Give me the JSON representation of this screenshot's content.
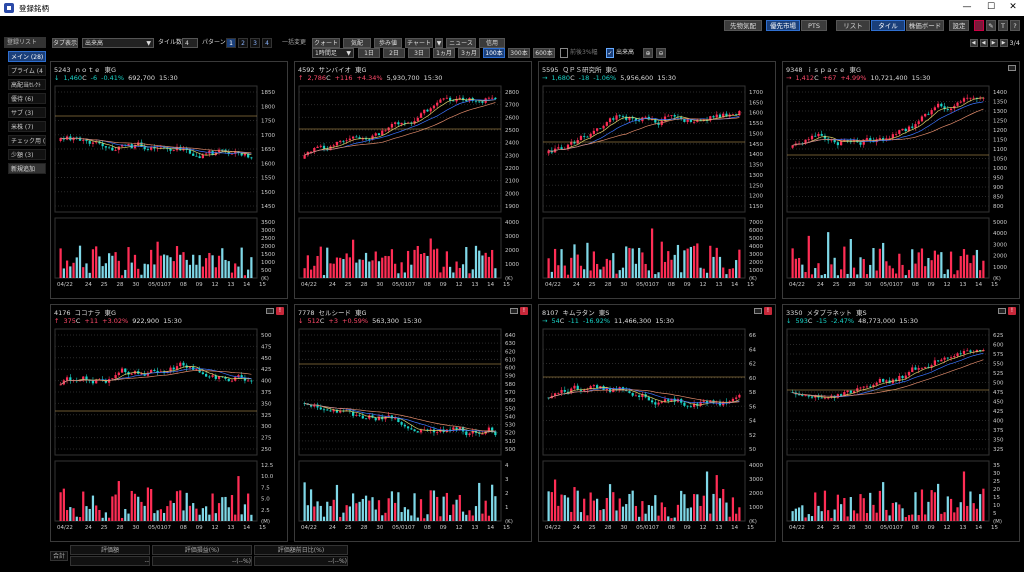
{
  "window": {
    "title": "登録銘柄",
    "minimize": "—",
    "maximize": "☐",
    "close": "✕"
  },
  "toolbar": {
    "buttons": [
      "先物気配",
      "優先市場",
      "PTS",
      "リスト",
      "タイル",
      "株価ボード",
      "設定"
    ]
  },
  "sidebar": {
    "header": "登録リスト",
    "items": [
      {
        "label": "メイン (28)",
        "active": true
      },
      {
        "label": "プライム (4",
        "active": false
      },
      {
        "label": "高配当ｾﾚｸﾄ",
        "active": false
      },
      {
        "label": "優待 (6)",
        "active": false
      },
      {
        "label": "サブ (3)",
        "active": false
      },
      {
        "label": "米株 (7)",
        "active": false
      },
      {
        "label": "チェック用 (",
        "active": false
      },
      {
        "label": "少額 (3)",
        "active": false
      }
    ],
    "add_label": "新規追加"
  },
  "controls": {
    "tab_label": "タブ表示",
    "sort_value": "出来高",
    "tile_count_label": "タイル数",
    "tile_count_value": "4",
    "pattern_label": "パターン",
    "patterns": [
      "1",
      "2",
      "3",
      "4"
    ],
    "bulk_change_label": "一括変更",
    "views": [
      "クォート",
      "気配",
      "歩み値",
      "チャート",
      "ニュース",
      "信用"
    ],
    "interval_value": "1時間足",
    "ranges": [
      "1日",
      "2日",
      "3日",
      "1ヵ月",
      "3ヵ月",
      "100本",
      "300本",
      "600本"
    ],
    "ranges_active": "100本",
    "check_limit_label": "前後3%幅",
    "check_volume_label": "出来高",
    "page_indicator": "3/4"
  },
  "tiles": [
    {
      "code": "5243",
      "name": "ｎｏｔｅ",
      "market": "東G",
      "arrow": "↓",
      "price": "1,460",
      "price_mark": "C",
      "change": "-6",
      "change_pct": "-0.41%",
      "volume": "692,700",
      "time": "15:30",
      "dir": "dn",
      "badge": "",
      "price_axis": [
        "1850",
        "1800",
        "1750",
        "1700",
        "1650",
        "1600",
        "1550",
        "1500",
        "1450"
      ],
      "vol_axis": [
        "3500",
        "3000",
        "2500",
        "2000",
        "1500",
        "1000",
        "500",
        "(K)"
      ],
      "x_axis": [
        "04/22",
        "24",
        "25",
        "28",
        "30",
        "05/01",
        "07",
        "08",
        "09",
        "12",
        "13",
        "14",
        "15"
      ]
    },
    {
      "code": "4592",
      "name": "サンバイオ",
      "market": "東G",
      "arrow": "↑",
      "price": "2,786",
      "price_mark": "C",
      "change": "+116",
      "change_pct": "+4.34%",
      "volume": "5,930,700",
      "time": "15:30",
      "dir": "up",
      "badge": "",
      "price_axis": [
        "2800",
        "2700",
        "2600",
        "2500",
        "2400",
        "2300",
        "2200",
        "2100",
        "2000",
        "1900"
      ],
      "vol_axis": [
        "4000",
        "3000",
        "2000",
        "1000",
        "(K)"
      ],
      "x_axis": [
        "04/22",
        "24",
        "25",
        "28",
        "30",
        "05/01",
        "07",
        "08",
        "09",
        "12",
        "13",
        "14",
        "15"
      ]
    },
    {
      "code": "5595",
      "name": "ＱＰＳ研究所",
      "market": "東G",
      "arrow": "→",
      "price": "1,680",
      "price_mark": "C",
      "change": "-18",
      "change_pct": "-1.06%",
      "volume": "5,956,600",
      "time": "15:30",
      "dir": "dn",
      "badge": "",
      "price_axis": [
        "1700",
        "1650",
        "1600",
        "1550",
        "1500",
        "1450",
        "1400",
        "1350",
        "1300",
        "1250",
        "1200",
        "1150"
      ],
      "vol_axis": [
        "7000",
        "6000",
        "5000",
        "4000",
        "3000",
        "2000",
        "1000",
        "(K)"
      ],
      "x_axis": [
        "04/22",
        "24",
        "25",
        "28",
        "30",
        "05/01",
        "07",
        "08",
        "09",
        "12",
        "13",
        "14",
        "15"
      ]
    },
    {
      "code": "9348",
      "name": "ｉｓｐａｃｅ",
      "market": "東G",
      "arrow": "→",
      "price": "1,412",
      "price_mark": "C",
      "change": "+67",
      "change_pct": "+4.99%",
      "volume": "10,721,400",
      "time": "15:30",
      "dir": "up",
      "badge": "",
      "price_axis": [
        "1400",
        "1350",
        "1300",
        "1250",
        "1200",
        "1150",
        "1100",
        "1050",
        "1000",
        "950",
        "900",
        "850",
        "800"
      ],
      "vol_axis": [
        "5000",
        "4000",
        "3000",
        "2000",
        "1000",
        "(K)"
      ],
      "x_axis": [
        "04/22",
        "24",
        "25",
        "28",
        "30",
        "05/01",
        "07",
        "08",
        "09",
        "12",
        "13",
        "14",
        "15"
      ]
    },
    {
      "code": "4176",
      "name": "ココナラ",
      "market": "東G",
      "arrow": "↑",
      "price": "375",
      "price_mark": "C",
      "change": "+11",
      "change_pct": "+3.02%",
      "volume": "922,900",
      "time": "15:30",
      "dir": "up",
      "badge": "!",
      "price_axis": [
        "500",
        "475",
        "450",
        "425",
        "400",
        "375",
        "350",
        "325",
        "300",
        "275",
        "250"
      ],
      "vol_axis": [
        "12.5",
        "10.0",
        "7.5",
        "5.0",
        "2.5",
        "(M)"
      ],
      "x_axis": [
        "04/22",
        "24",
        "25",
        "28",
        "30",
        "05/01",
        "07",
        "08",
        "09",
        "12",
        "13",
        "14",
        "15"
      ]
    },
    {
      "code": "7778",
      "name": "セルシード",
      "market": "東G",
      "arrow": "↓",
      "price": "512",
      "price_mark": "C",
      "change": "+3",
      "change_pct": "+0.59%",
      "volume": "563,300",
      "time": "15:30",
      "dir": "up",
      "badge": "!",
      "price_axis": [
        "640",
        "630",
        "620",
        "610",
        "600",
        "590",
        "580",
        "570",
        "560",
        "550",
        "540",
        "530",
        "520",
        "510",
        "500"
      ],
      "vol_axis": [
        "4",
        "3",
        "2",
        "1",
        "(K)"
      ],
      "x_axis": [
        "04/22",
        "24",
        "25",
        "28",
        "30",
        "05/01",
        "07",
        "08",
        "09",
        "12",
        "13",
        "14",
        "15"
      ]
    },
    {
      "code": "8107",
      "name": "キムラタン",
      "market": "東S",
      "arrow": "→",
      "price": "54",
      "price_mark": "C",
      "change": "-11",
      "change_pct": "-16.92%",
      "volume": "11,466,300",
      "time": "15:30",
      "dir": "dn",
      "badge": "!",
      "price_axis": [
        "66",
        "64",
        "62",
        "60",
        "58",
        "56",
        "54",
        "52",
        "50"
      ],
      "vol_axis": [
        "4000",
        "3000",
        "2000",
        "1000",
        "(K)"
      ],
      "x_axis": [
        "04/22",
        "24",
        "25",
        "28",
        "30",
        "05/01",
        "07",
        "08",
        "09",
        "12",
        "13",
        "14",
        "15"
      ]
    },
    {
      "code": "3350",
      "name": "メタプラネット",
      "market": "東S",
      "arrow": "↓",
      "price": "593",
      "price_mark": "C",
      "change": "-15",
      "change_pct": "-2.47%",
      "volume": "48,773,000",
      "time": "15:30",
      "dir": "dn",
      "badge": "!",
      "price_axis": [
        "625",
        "600",
        "575",
        "550",
        "525",
        "500",
        "475",
        "450",
        "425",
        "400",
        "375",
        "350",
        "325"
      ],
      "vol_axis": [
        "35",
        "30",
        "25",
        "20",
        "15",
        "10",
        "5",
        "(M)"
      ],
      "x_axis": [
        "04/22",
        "24",
        "25",
        "28",
        "30",
        "05/01",
        "07",
        "08",
        "09",
        "12",
        "13",
        "14",
        "15"
      ]
    }
  ],
  "summary": {
    "row_label": "合計",
    "headers": [
      "評価額",
      "評価損益(%)",
      "評価額前日比(%)"
    ],
    "values": [
      "--",
      "--(--%)",
      "--(--%)"
    ]
  },
  "colors": {
    "up": "#ff2d55",
    "down": "#19d2c6",
    "ma_short": "#d8d26b",
    "ma_mid": "#3b74ff",
    "ma_long": "#e08a6a",
    "grid": "#2a2a2a",
    "accent": "#1a3f7a"
  }
}
